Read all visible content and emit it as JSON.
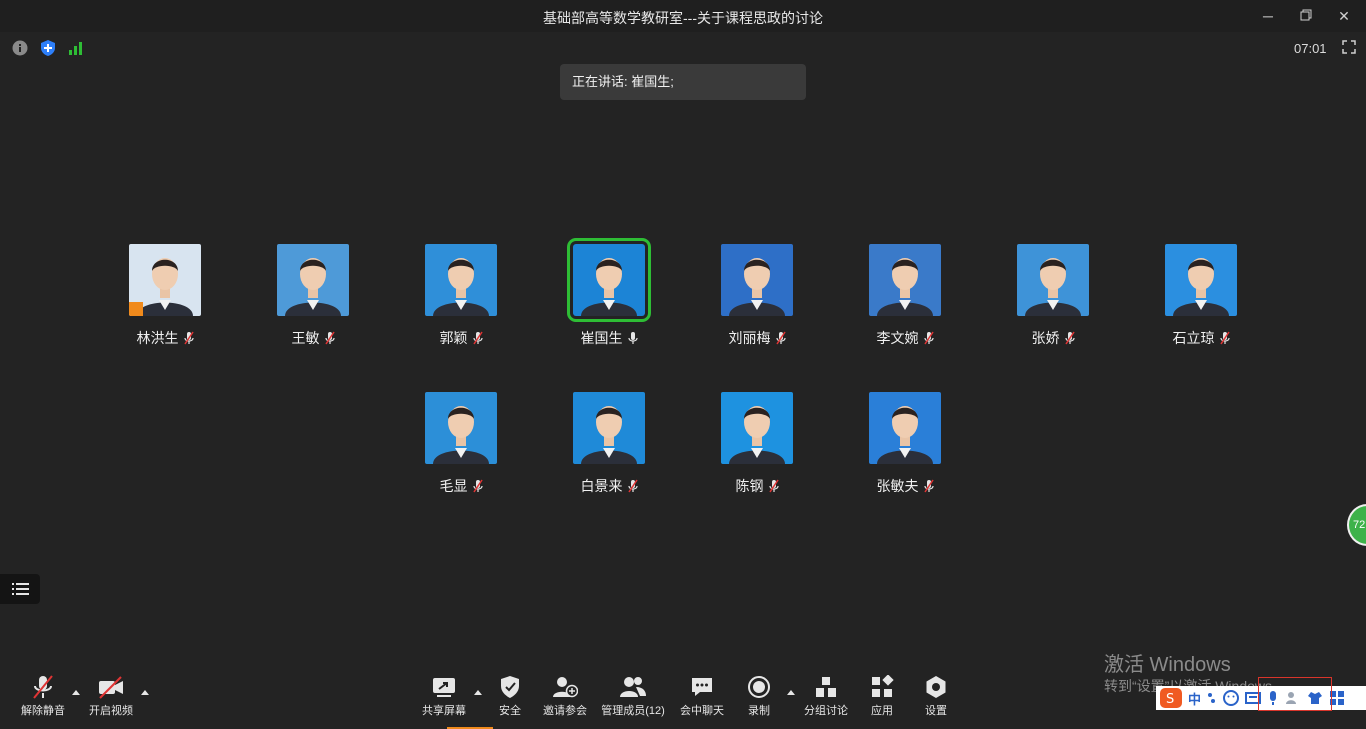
{
  "window": {
    "title": "基础部高等数学教研室---关于课程思政的讨论",
    "clock": "07:01",
    "min_icon": "minimize-icon",
    "restore_icon": "restore-icon",
    "close_icon": "close-icon"
  },
  "speaking": {
    "text": "正在讲话: 崔国生;"
  },
  "participants": [
    {
      "name": "林洪生",
      "mic": "muted",
      "bg": "#d8e4f0"
    },
    {
      "name": "王敏",
      "mic": "muted",
      "bg": "#4e9ad8"
    },
    {
      "name": "郭颖",
      "mic": "muted",
      "bg": "#2f8fd9"
    },
    {
      "name": "崔国生",
      "mic": "on",
      "active": true,
      "bg": "#1c84d6"
    },
    {
      "name": "刘丽梅",
      "mic": "muted",
      "bg": "#2e6fc7"
    },
    {
      "name": "李文婉",
      "mic": "muted",
      "bg": "#3a7ac9"
    },
    {
      "name": "张娇",
      "mic": "muted",
      "bg": "#3e93d8"
    },
    {
      "name": "石立琼",
      "mic": "muted",
      "bg": "#2b8fe0"
    },
    {
      "name": "毛显",
      "mic": "muted",
      "bg": "#2c8fd8"
    },
    {
      "name": "白景来",
      "mic": "muted",
      "bg": "#1f8ad8"
    },
    {
      "name": "陈钢",
      "mic": "muted",
      "bg": "#1e92e0"
    },
    {
      "name": "张敏夫",
      "mic": "muted",
      "bg": "#2a7fd8"
    }
  ],
  "toolbar": {
    "unmute": "解除静音",
    "start_video": "开启视频",
    "share": "共享屏幕",
    "security": "安全",
    "invite": "邀请参会",
    "manage": "管理成员(12)",
    "chat": "会中聊天",
    "record": "录制",
    "breakout": "分组讨论",
    "apps": "应用",
    "settings": "设置"
  },
  "overlay": {
    "green_badge": "72",
    "watermark_title": "激活 Windows",
    "watermark_sub": "转到“设置”以激活 Windows。",
    "ime_lang": "中"
  },
  "colors": {
    "background": "#232323",
    "active_border": "#2ebd35",
    "green_signal": "#2ebd35",
    "shield_blue": "#2d7ff9"
  }
}
